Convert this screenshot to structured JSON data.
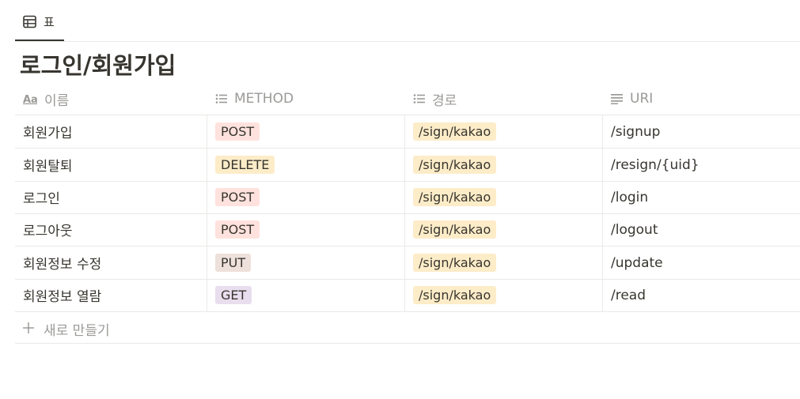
{
  "tabs": [
    {
      "label": "표",
      "icon": "table-icon"
    }
  ],
  "page": {
    "title": "로그인/회원가입"
  },
  "columns": [
    {
      "label": "이름",
      "icon": "text-type-icon"
    },
    {
      "label": "METHOD",
      "icon": "list-icon"
    },
    {
      "label": "경로",
      "icon": "list-icon"
    },
    {
      "label": "URI",
      "icon": "text-lines-icon"
    }
  ],
  "rows": [
    {
      "name": "회원가입",
      "method": "POST",
      "path": "/sign/kakao",
      "uri": "/signup"
    },
    {
      "name": "회원탈퇴",
      "method": "DELETE",
      "path": "/sign/kakao",
      "uri": "/resign/{uid}"
    },
    {
      "name": "로그인",
      "method": "POST",
      "path": "/sign/kakao",
      "uri": "/login"
    },
    {
      "name": "로그아웃",
      "method": "POST",
      "path": "/sign/kakao",
      "uri": "/logout"
    },
    {
      "name": "회원정보 수정",
      "method": "PUT",
      "path": "/sign/kakao",
      "uri": "/update"
    },
    {
      "name": "회원정보 열람",
      "method": "GET",
      "path": "/sign/kakao",
      "uri": "/read"
    }
  ],
  "new_row_label": "새로 만들기",
  "tag_colors": {
    "POST": "#ffe2dd",
    "DELETE": "#fdecc8",
    "PUT": "#eee0da",
    "GET": "#e8deee",
    "/sign/kakao": "#fdecc8"
  }
}
